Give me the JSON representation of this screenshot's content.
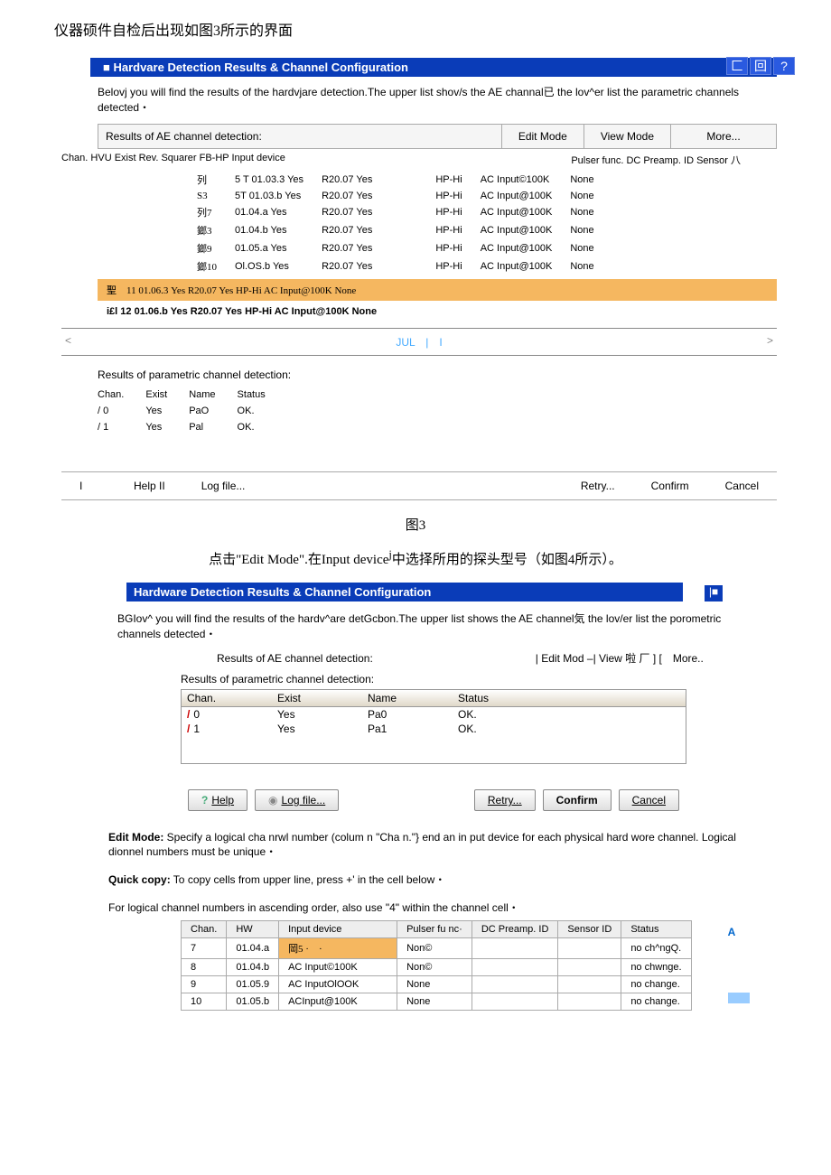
{
  "intro": "仪器硕件自检后出现如图3所示的界面",
  "win1": {
    "title": "■ Hardvare Detection Results & Channel Configuration",
    "desc_a": "Belovj you will find the results of the hardvjare detection.The upper list shov/s the AE channal",
    "desc_cjk": "已",
    "desc_b": " the lov^er list the parametric channels detected・",
    "results_label": "Results of AE channel detection:",
    "btn_edit": "Edit Mode",
    "btn_view": "View Mode",
    "btn_more": "More...",
    "hdr_left": "Chan. HVU Exist Rev. Squarer FB-HP Input device",
    "hdr_right": "Pulser func. DC Preamp. ID Sensor 八",
    "rows": [
      {
        "a": "列",
        "b": "5 T 01.03.3 Yes",
        "c": "R20.07 Yes",
        "d": "HP-Hi",
        "e": "AC Input©100K",
        "f": "None"
      },
      {
        "a": "S3",
        "b": "5T 01.03.b Yes",
        "c": "R20.07 Yes",
        "d": "HP-Hi",
        "e": "AC Input@100K",
        "f": "None"
      },
      {
        "a": "列7",
        "b": "01.04.a Yes",
        "c": "R20.07 Yes",
        "d": "HP-Hi",
        "e": "AC Input@100K",
        "f": "None"
      },
      {
        "a": "鎯3",
        "b": "01.04.b Yes",
        "c": "R20.07 Yes",
        "d": "HP-Hi",
        "e": "AC Input@100K",
        "f": "None"
      },
      {
        "a": "鎯9",
        "b": "01.05.a Yes",
        "c": "R20.07 Yes",
        "d": "HP-Hi",
        "e": "AC Input@100K",
        "f": "None"
      },
      {
        "a": "鎯10",
        "b": "Ol.OS.b Yes",
        "c": "R20.07 Yes",
        "d": "HP-Hi",
        "e": "AC Input@100K",
        "f": "None"
      }
    ],
    "hlrow": "聖　11 01.06.3 Yes R20.07 Yes HP-Hi AC Input@100K None",
    "lastrow": "i£l 12 01.06.b Yes R20.07 Yes HP-Hi AC Input@100K None",
    "scroll_l": "<",
    "scroll_mid": "JUL　|　I",
    "scroll_r": ">",
    "param_label": "Results of parametric channel detection:",
    "ph": {
      "a": "Chan.",
      "b": "Exist",
      "c": "Name",
      "d": "Status"
    },
    "pr": [
      {
        "a": "/ 0",
        "b": "Yes",
        "c": "PaO",
        "d": "OK."
      },
      {
        "a": "/ 1",
        "b": "Yes",
        "c": "Pal",
        "d": "OK."
      }
    ],
    "b_help": "Help II",
    "b_log": "Log file...",
    "b_retry": "Retry...",
    "b_confirm": "Confirm",
    "b_cancel": "Cancel"
  },
  "caption1": "图3",
  "caption2a": "点击\"Edit Mode\".在Input device",
  "caption2b": "中选择所用的探头型号（如图4所示）。",
  "win2": {
    "title": "Hardware Detection Results & Channel Configuration",
    "end": "|■",
    "desc_a": "BGIov^ you will find the results of the hardv^are detGcbon.The upper list shows the AE channel",
    "desc_cjk": "気",
    "desc_b": " the lov/er list the porometric channels detected・",
    "results_label": "Results of AE channel detection:",
    "rtoolbar": "| Edit Mod –| View 啦 厂 ] [　More..",
    "param_label": "Results of parametric channel detection:",
    "ph": {
      "a": "Chan.",
      "b": "Exist",
      "c": "Name",
      "d": "Status"
    },
    "pr": [
      {
        "a": "0",
        "b": "Yes",
        "c": "Pa0",
        "d": "OK."
      },
      {
        "a": "1",
        "b": "Yes",
        "c": "Pa1",
        "d": "OK."
      }
    ],
    "b_help": "Help",
    "b_log": "Log file...",
    "b_retry": "Retry...",
    "b_confirm": "Confirm",
    "b_cancel": "Cancel",
    "note1a": "Edit Mode:",
    "note1b": " Specify a logical cha nrwl number (colum n \"Cha n.\"} end an in put device for each physical hard wore channel. Logical dionnel numbers must be unique・",
    "note2a": "Quick copy:",
    "note2b": " To copy cells from upper line, press +' in the cell below・",
    "note3": "For logical channel numbers in ascending order, also use \"4\" within the channel cell・",
    "eh": {
      "a": "Chan.",
      "b": "HW",
      "c": "Input device",
      "d": "Pulser fu nc·",
      "e": "DC Preamp. ID",
      "f": "Sensor ID",
      "g": "Status"
    },
    "er": [
      {
        "a": "7",
        "b": "01.04.a",
        "c": "岡5 ·　·",
        "d": "Non©",
        "e": "",
        "f": "",
        "g": "no ch^ngQ.",
        "hl": true
      },
      {
        "a": "8",
        "b": "01.04.b",
        "c": "AC Input©100K",
        "d": "Non©",
        "e": "",
        "f": "",
        "g": "no chwnge.",
        "hl": false
      },
      {
        "a": "9",
        "b": "01.05.9",
        "c": "AC InputOlOOK",
        "d": "None",
        "e": "",
        "f": "",
        "g": "no change.",
        "hl": false
      },
      {
        "a": "10",
        "b": "01.05.b",
        "c": "ACInput@100K",
        "d": "None",
        "e": "",
        "f": "",
        "g": "no change.",
        "hl": false
      }
    ],
    "sideA": "A"
  }
}
